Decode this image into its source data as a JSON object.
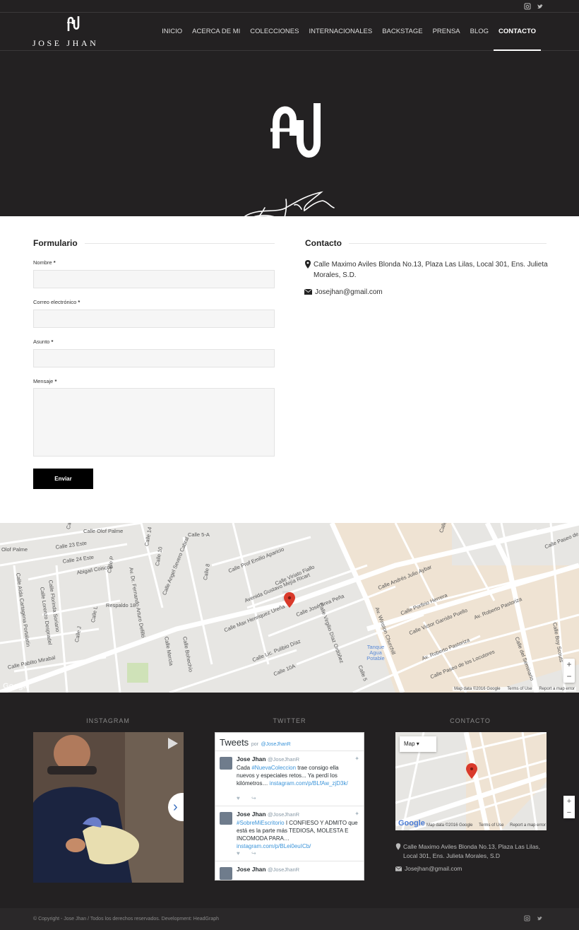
{
  "brand": {
    "name": "JOSE JHAN",
    "logo_mark": "JJ monogram logo",
    "signature": "Jose Jhan"
  },
  "social": {
    "instagram_icon": "instagram-icon",
    "twitter_icon": "twitter-icon"
  },
  "nav": {
    "items": [
      {
        "label": "INICIO"
      },
      {
        "label": "ACERCA DE MI"
      },
      {
        "label": "COLECCIONES"
      },
      {
        "label": "INTERNACIONALES"
      },
      {
        "label": "BACKSTAGE"
      },
      {
        "label": "PRENSA"
      },
      {
        "label": "BLOG"
      },
      {
        "label": "CONTACTO",
        "active": true
      }
    ]
  },
  "form": {
    "title": "Formulario",
    "name_label": "Nombre",
    "email_label": "Correo electrónico",
    "subject_label": "Asunto",
    "message_label": "Mensaje",
    "required_mark": "*",
    "submit_label": "Enviar"
  },
  "contact": {
    "title": "Contacto",
    "address": "Calle Maximo Aviles Blonda No.13, Plaza Las Lilas, Local 301, Ens. Julieta Morales, S.D.",
    "email": "Josejhan@gmail.com"
  },
  "map": {
    "labels": [
      "Calle Olof Palme",
      "Olof Palme",
      "Calle 23 Este",
      "Calle 24 Este",
      "Abigail Coiscou",
      "Calle 14",
      "Calle 10",
      "Calle 5-A",
      "Calle Prof Emilio Aparicio",
      "Calle Viriato Fiallo",
      "Avenida Gustavo Mejía Ricart",
      "Calle Max Henriquez Ureña",
      "Calle José Brea Peña",
      "Calle Virgilio Díaz Ordóñez",
      "Av. Winston Churchill",
      "Calle Andrés Julio Aybar",
      "Calle Federico Geraldino",
      "Calle Porfirio Herrera",
      "Calle Victor Garrido Puello",
      "Av. Roberto Pastoriza",
      "Calle Paseo de los Locutores",
      "Calle del Seminario",
      "Respaldo 18",
      "Calle P",
      "Calle L",
      "Calle J",
      "Calle Pablito Mirabal",
      "Calle Aída Cartagena Portalatín",
      "Calle Lorenzo Despradel",
      "Calle Florinda Soriano",
      "Calle Mercia",
      "Calle Bohechío",
      "Calle Angel Severo Cabral",
      "Av. Dr. Fernando Arturo Defilló",
      "Calle Lic. Pulibio Díaz",
      "Calle 10A",
      "Calle 5",
      "Tanque Agua Potable",
      "Calle Boy Scouts",
      "Calle Paseo de los Periodistas",
      "Av. Roberto Pastoriza",
      "Calle 8",
      "Calle 3"
    ],
    "credit": "Map data ©2016 Google",
    "terms": "Terms of Use",
    "report": "Report a map error",
    "google": "Google",
    "zoom_in": "+",
    "zoom_out": "−"
  },
  "footer": {
    "instagram_title": "INSTAGRAM",
    "twitter_title": "TWITTER",
    "contact_title": "CONTACTO",
    "twitter": {
      "header": "Tweets",
      "por": "por",
      "handle": "@JoseJhanR",
      "tweets": [
        {
          "name": "Jose Jhan",
          "handle": "@JoseJhanR",
          "hashtag": "#NuevaColeccion",
          "text_before": "Cada",
          "text_after": "trae consigo ella nuevos y especiales retos... Ya perdí los kilómetros…",
          "link": "instagram.com/p/BLfAw_zjD3k/"
        },
        {
          "name": "Jose Jhan",
          "handle": "@JoseJhanR",
          "hashtag": "#SobreMiEscritorio",
          "text_before": "",
          "text_after": "I CONFIESO Y ADMITO que está es la parte más TEDIOSA, MOLESTA E INCOMODA PARA…",
          "link": "instagram.com/p/BLei0euICb/"
        },
        {
          "name": "Jose Jhan",
          "handle": "@JoseJhanR"
        }
      ]
    },
    "minimap": {
      "type_select": "Map",
      "credit": "Map data ©2016 Google",
      "terms": "Terms of Use",
      "report": "Report a map error",
      "google": "Google"
    },
    "address": "Calle Maximo Aviles Blonda No.13, Plaza Las Lilas, Local 301, Ens. Julieta Morales, S.D",
    "email": "Josejhan@gmail.com"
  },
  "copyright": "© Copyright - Jose Jhan / Todos los derechos reservados. Development: HeadGraph",
  "colors": {
    "dark": "#232122",
    "map_bg": "#e7e6e3",
    "accent_link": "#3b94d9",
    "marker": "#d93a2b"
  }
}
